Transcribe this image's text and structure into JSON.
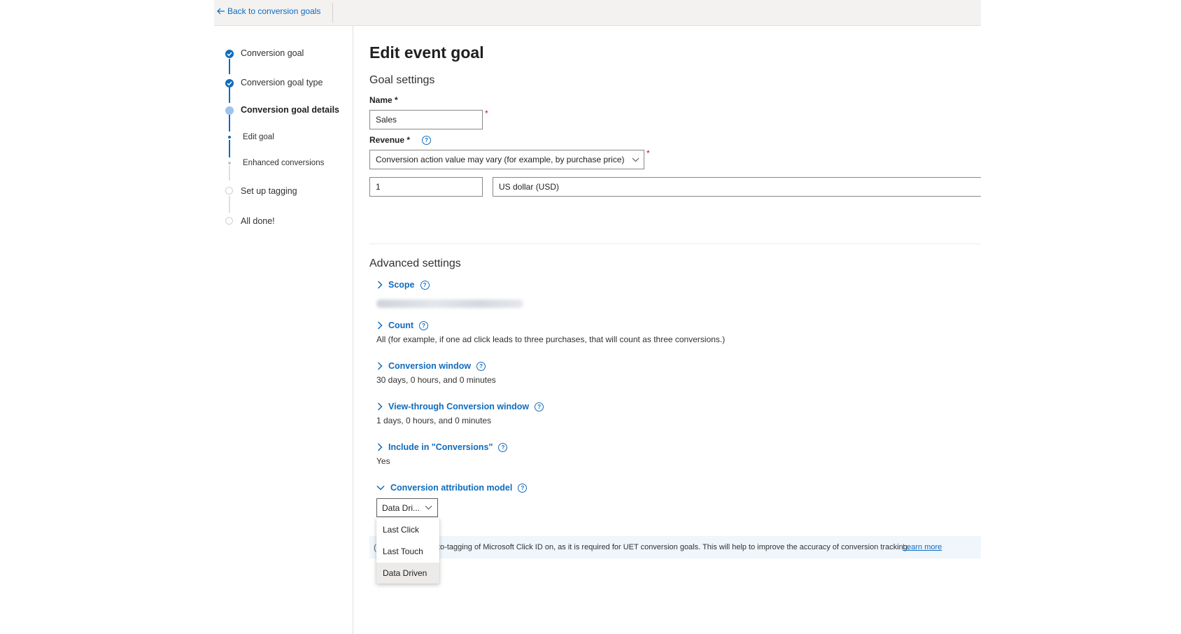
{
  "topbar": {
    "back_label": "Back to conversion goals"
  },
  "steps": [
    {
      "label": "Conversion goal",
      "state": "done"
    },
    {
      "label": "Conversion goal type",
      "state": "done"
    },
    {
      "label": "Conversion goal details",
      "state": "current"
    },
    {
      "label": "Edit goal",
      "state": "sub-current"
    },
    {
      "label": "Enhanced conversions",
      "state": "sub"
    },
    {
      "label": "Set up tagging",
      "state": "todo"
    },
    {
      "label": "All done!",
      "state": "todo"
    }
  ],
  "main": {
    "title": "Edit event goal",
    "goal_settings_heading": "Goal settings",
    "name_label": "Name *",
    "name_value": "Sales",
    "revenue_label": "Revenue *",
    "revenue_option": "Conversion action value may vary (for example, by purchase price)",
    "revenue_amount": "1",
    "currency": "US dollar (USD)",
    "required_mark": "*",
    "help_glyph": "?"
  },
  "advanced": {
    "heading": "Advanced settings",
    "scope_label": "Scope",
    "count_label": "Count",
    "count_value": "All (for example, if one ad click leads to three purchases, that will count as three conversions.)",
    "window_label": "Conversion window",
    "window_value": "30 days, 0 hours, and 0 minutes",
    "view_window_label": "View-through Conversion window",
    "view_window_value": "1 days, 0 hours, and 0 minutes",
    "include_label": "Include in \"Conversions\"",
    "include_value": "Yes",
    "attribution_label": "Conversion attribution model",
    "attribution_selected": "Data Dri...",
    "attribution_options": [
      "Last Click",
      "Last Touch",
      "Data Driven"
    ]
  },
  "info_bar": {
    "text": "to-tagging of Microsoft Click ID on, as it is required for UET conversion goals. This will help to improve the accuracy of conversion tracking.",
    "learn_more": "Learn more"
  },
  "colors": {
    "accent": "#0f6cbd",
    "required": "#c50f1f",
    "info_bg": "#eff6fc"
  }
}
